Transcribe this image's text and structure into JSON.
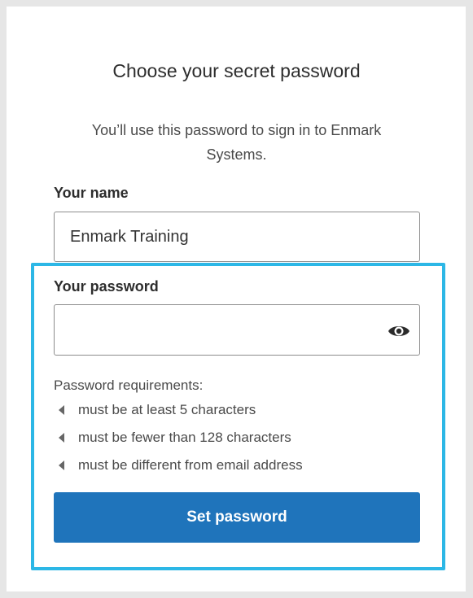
{
  "header": {
    "title": "Choose your secret password",
    "subtitle": "You’ll use this password to sign in to Enmark Systems."
  },
  "name_field": {
    "label": "Your name",
    "value": "Enmark Training"
  },
  "password_field": {
    "label": "Your password",
    "value": "",
    "icon": "eye-icon"
  },
  "requirements": {
    "title": "Password requirements:",
    "items": [
      "must be at least 5 characters",
      "must be fewer than 128 characters",
      "must be different from email address"
    ]
  },
  "submit": {
    "label": "Set password"
  },
  "colors": {
    "primary": "#1f74bb",
    "highlight": "#2cb7e6",
    "page_bg": "#e6e6e6"
  }
}
